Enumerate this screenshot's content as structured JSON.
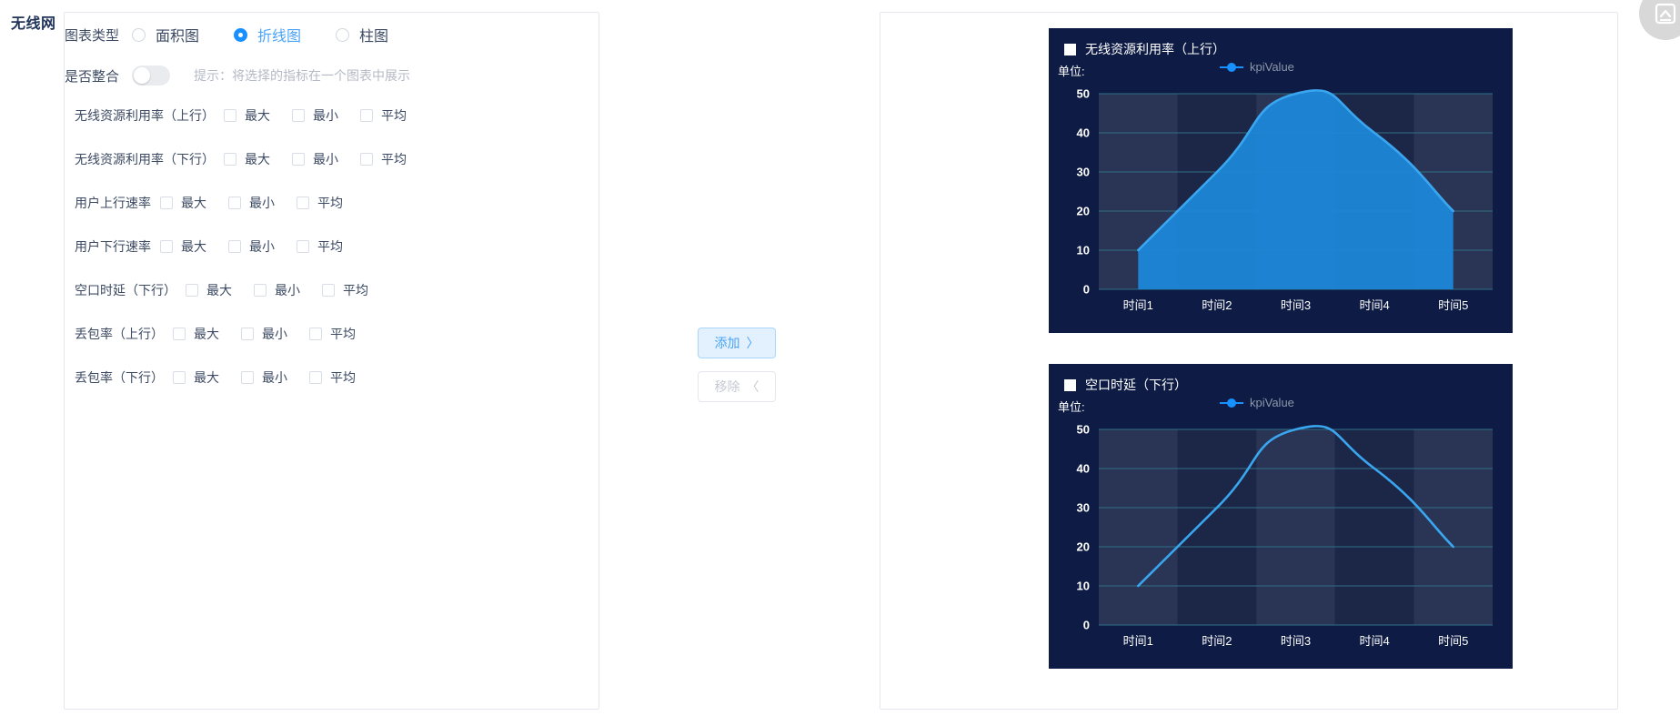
{
  "tab": {
    "label": "无线网"
  },
  "form": {
    "chart_type": {
      "label": "图表类型",
      "options": [
        {
          "label": "面积图",
          "checked": false
        },
        {
          "label": "折线图",
          "checked": true
        },
        {
          "label": "柱图",
          "checked": false
        }
      ]
    },
    "merge": {
      "label": "是否整合",
      "enabled": false,
      "hint": "提示：将选择的指标在一个图表中展示"
    },
    "metrics": [
      {
        "name": "无线资源利用率（上行）",
        "options": [
          "最大",
          "最小",
          "平均"
        ]
      },
      {
        "name": "无线资源利用率（下行）",
        "options": [
          "最大",
          "最小",
          "平均"
        ]
      },
      {
        "name": "用户上行速率",
        "options": [
          "最大",
          "最小",
          "平均"
        ]
      },
      {
        "name": "用户下行速率",
        "options": [
          "最大",
          "最小",
          "平均"
        ]
      },
      {
        "name": "空口时延（下行）",
        "options": [
          "最大",
          "最小",
          "平均"
        ]
      },
      {
        "name": "丢包率（上行）",
        "options": [
          "最大",
          "最小",
          "平均"
        ]
      },
      {
        "name": "丢包率（下行）",
        "options": [
          "最大",
          "最小",
          "平均"
        ]
      }
    ]
  },
  "transfer": {
    "add_label": "添加",
    "add_arrow": "〉",
    "remove_label": "移除",
    "remove_arrow": "〈"
  },
  "fab": {
    "icon": "image-collapse-icon"
  },
  "colors": {
    "accent": "#1890ff",
    "chart_bg": "#0e1c45",
    "band_light": "#2a3455",
    "band_dark": "#1c2748",
    "gridline": "#2f6f86",
    "line": "#2196f3",
    "area_fill": "#1c87d8"
  },
  "chart_data": [
    {
      "type": "area",
      "title": "无线资源利用率（上行）",
      "unit_label": "单位:",
      "unit_value": "",
      "legend": [
        "kpiValue"
      ],
      "legend_position": "top-center",
      "categories": [
        "时间1",
        "时间2",
        "时间3",
        "时间4",
        "时间5"
      ],
      "series": [
        {
          "name": "kpiValue",
          "values": [
            10,
            30,
            50,
            40,
            20
          ]
        }
      ],
      "yticks": [
        0,
        10,
        20,
        30,
        40,
        50
      ],
      "ylim": [
        0,
        50
      ],
      "xlabel": "",
      "ylabel": "",
      "grid": true
    },
    {
      "type": "line",
      "title": "空口时延（下行）",
      "unit_label": "单位:",
      "unit_value": "",
      "legend": [
        "kpiValue"
      ],
      "legend_position": "top-center",
      "categories": [
        "时间1",
        "时间2",
        "时间3",
        "时间4",
        "时间5"
      ],
      "series": [
        {
          "name": "kpiValue",
          "values": [
            10,
            30,
            50,
            40,
            20
          ]
        }
      ],
      "yticks": [
        0,
        10,
        20,
        30,
        40,
        50
      ],
      "ylim": [
        0,
        50
      ],
      "xlabel": "",
      "ylabel": "",
      "grid": true
    }
  ]
}
